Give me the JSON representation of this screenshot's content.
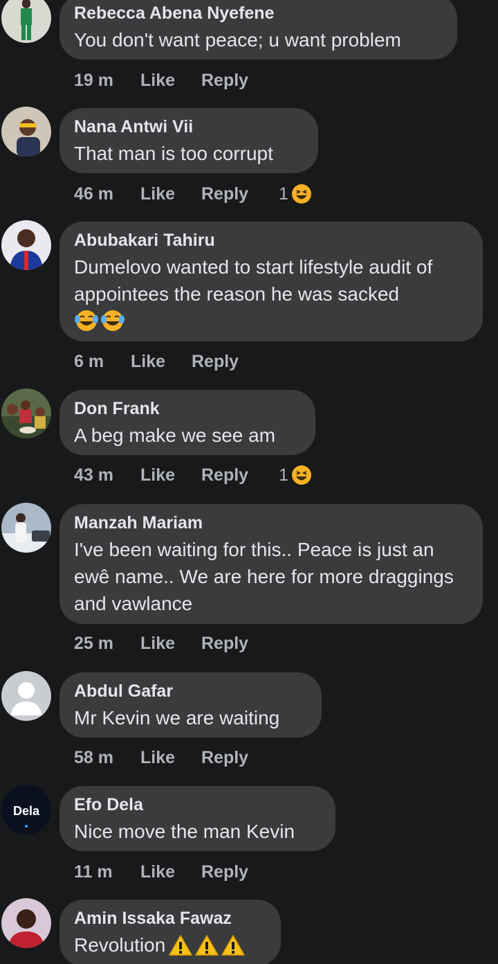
{
  "comments": [
    {
      "author": "Rebecca Abena Nyefene",
      "text": "You don't want peace; u want problem",
      "time": "19 m",
      "like": "Like",
      "reply": "Reply"
    },
    {
      "author": "Nana Antwi Vii",
      "text": "That man is too corrupt",
      "time": "46 m",
      "like": "Like",
      "reply": "Reply",
      "reactions": "1",
      "reaction_icon": "laughing-emoji-icon"
    },
    {
      "author": "Abubakari Tahiru",
      "text": "Dumelovo wanted to start lifestyle audit of appointees the reason he was sacked",
      "time": "6 m",
      "like": "Like",
      "reply": "Reply",
      "emoji_icon": "tears-of-joy-emoji-icon"
    },
    {
      "author": "Don Frank",
      "text": "A beg make we see am",
      "time": "43 m",
      "like": "Like",
      "reply": "Reply",
      "reactions": "1",
      "reaction_icon": "laughing-emoji-icon"
    },
    {
      "author": "Manzah Mariam",
      "text": "I've been waiting for this.. Peace is just an ewê name.. We are here for more draggings and vawlance",
      "time": "25 m",
      "like": "Like",
      "reply": "Reply"
    },
    {
      "author": "Abdul Gafar",
      "text": "Mr Kevin we are waiting",
      "time": "58 m",
      "like": "Like",
      "reply": "Reply"
    },
    {
      "author": "Efo Dela",
      "text": "Nice move the man Kevin",
      "time": "11 m",
      "like": "Like",
      "reply": "Reply",
      "avatar_text": "Dela"
    },
    {
      "author": "Amin Issaka Fawaz",
      "text": "Revolution",
      "emoji_icon": "warning-emoji-icon"
    }
  ],
  "colors": {
    "background": "#18191a",
    "bubble": "#3a3b3c",
    "text": "#e4e6eb",
    "meta": "#b0b3b8",
    "emoji": "#f7b125"
  }
}
